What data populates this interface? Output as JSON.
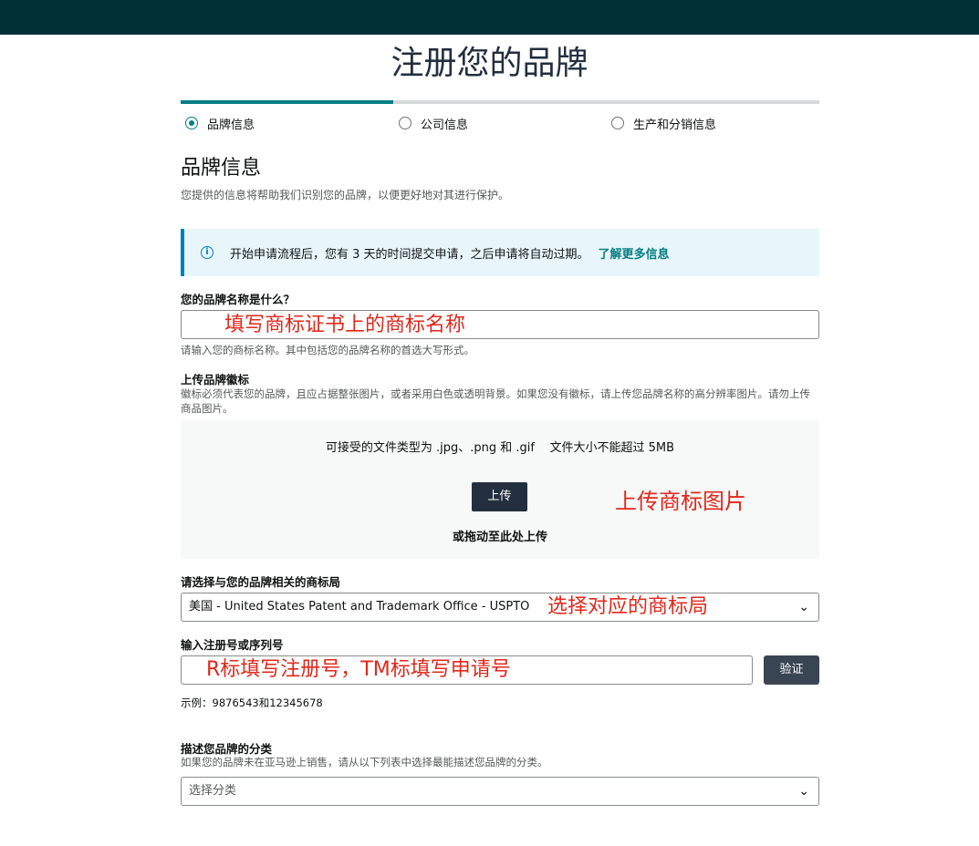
{
  "page": {
    "title": "注册您的品牌"
  },
  "progress": {
    "fraction": 0.333
  },
  "steps": [
    {
      "label": "品牌信息",
      "active": true
    },
    {
      "label": "公司信息",
      "active": false
    },
    {
      "label": "生产和分销信息",
      "active": false
    }
  ],
  "section": {
    "title": "品牌信息",
    "description": "您提供的信息将帮助我们识别您的品牌，以便更好地对其进行保护。"
  },
  "alert": {
    "icon": "info-icon",
    "text": "开始申请流程后，您有 3 天的时间提交申请，之后申请将自动过期。",
    "link": "了解更多信息"
  },
  "brand_name": {
    "label": "您的品牌名称是什么？",
    "value": "",
    "hint": "请输入您的商标名称。其中包括您的品牌名称的首选大写形式。",
    "annotation": "填写商标证书上的商标名称"
  },
  "logo_upload": {
    "label": "上传品牌徽标",
    "hint": "徽标必须代表您的品牌，且应占据整张图片，或者采用白色或透明背景。如果您没有徽标，请上传您品牌名称的高分辨率图片。请勿上传商品图片。",
    "accepted_types": "可接受的文件类型为 .jpg、.png 和 .gif    文件大小不能超过 5MB",
    "button": "上传",
    "drag_text": "或拖动至此处上传",
    "annotation": "上传商标图片"
  },
  "trademark_office": {
    "label": "请选择与您的品牌相关的商标局",
    "selected": "美国 - United States Patent and Trademark Office - USPTO",
    "annotation": "选择对应的商标局"
  },
  "registration_number": {
    "label": "输入注册号或序列号",
    "value": "",
    "verify_button": "验证",
    "example": "示例：9876543和12345678",
    "annotation": "R标填写注册号，TM标填写申请号"
  },
  "category": {
    "label": "描述您品牌的分类",
    "hint": "如果您的品牌未在亚马逊上销售，请从以下列表中选择最能描述您品牌的分类。",
    "placeholder": "选择分类"
  },
  "colors": {
    "topbar": "#002f36",
    "accent": "#067d83",
    "annotation": "#e3271b",
    "button_dark": "#232f3e"
  }
}
